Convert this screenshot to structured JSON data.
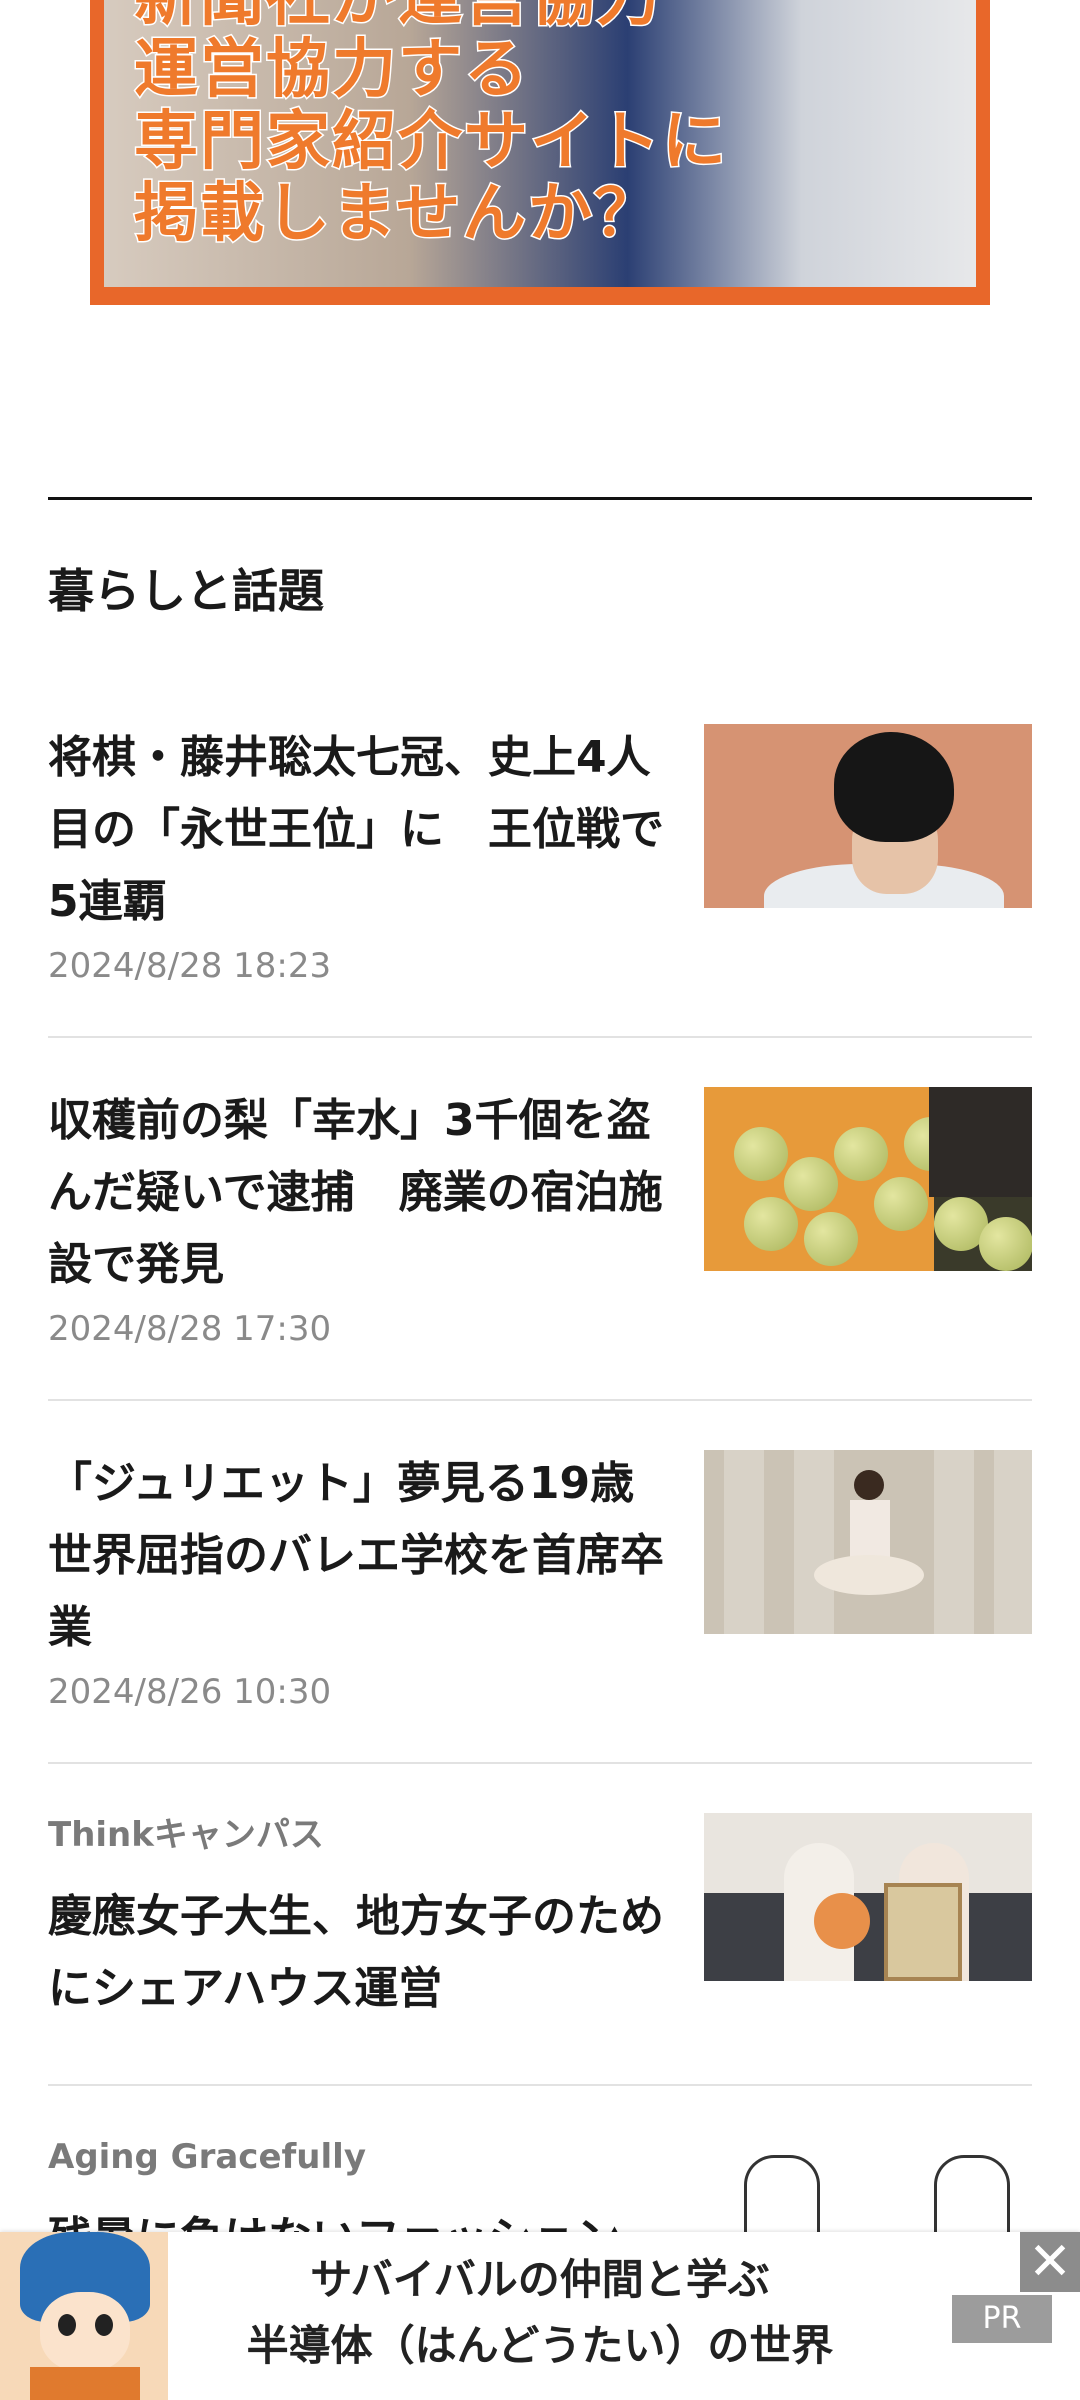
{
  "top_ad": {
    "lines": [
      "新聞社が運営協力",
      "運営協力する",
      "専門家紹介サイトに",
      "掲載しませんか？"
    ]
  },
  "section": {
    "title": "暮らしと話題"
  },
  "articles": [
    {
      "kicker": "",
      "headline": "将棋・藤井聡太七冠、史上4人目の「永世王位」に　王位戦で5連覇",
      "date": "2024/8/28 18:23",
      "thumb": "shogi-player-photo"
    },
    {
      "kicker": "",
      "headline": "収穫前の梨「幸水」3千個を盗んだ疑いで逮捕　廃業の宿泊施設で発見",
      "date": "2024/8/28 17:30",
      "thumb": "pears-photo"
    },
    {
      "kicker": "",
      "headline": "「ジュリエット」夢見る19歳　世界屈指のバレエ学校を首席卒業",
      "date": "2024/8/26 10:30",
      "thumb": "ballerina-photo"
    },
    {
      "kicker": "Thinkキャンパス",
      "headline": "慶應女子大生、地方女子のためにシェアハウス運営",
      "date": "",
      "thumb": "students-photo"
    },
    {
      "kicker": "Aging Gracefully",
      "headline": "残暑に負けないファッション",
      "date": "",
      "thumb": "how-to-wear-illustration"
    }
  ],
  "bottom_ad": {
    "line1": "サバイバルの仲間と学ぶ",
    "line2": "半導体（はんどうたい）の世界",
    "badge": "PR",
    "close": "✕"
  }
}
